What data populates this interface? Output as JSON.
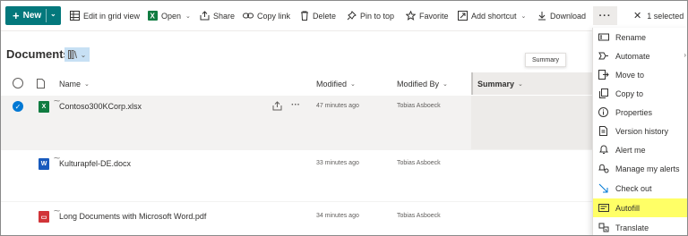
{
  "colors": {
    "accent": "#03787c",
    "selection_blue": "#0078d4",
    "highlight": "#ffff66",
    "excel_green": "#107c41",
    "word_blue": "#185abd",
    "pdf_red": "#d13438"
  },
  "toolbar": {
    "new_label": "New",
    "edit_grid_label": "Edit in grid view",
    "open_label": "Open",
    "share_label": "Share",
    "copy_link_label": "Copy link",
    "delete_label": "Delete",
    "pin_label": "Pin to top",
    "favorite_label": "Favorite",
    "add_shortcut_label": "Add shortcut",
    "download_label": "Download",
    "more_label": "···",
    "selected_label": "1 selected"
  },
  "library": {
    "title": "Documents"
  },
  "tooltip": {
    "text": "Summary"
  },
  "columns": {
    "name": "Name",
    "modified": "Modified",
    "modified_by": "Modified By",
    "summary": "Summary"
  },
  "files": [
    {
      "name": "Contoso300KCorp.xlsx",
      "type": "excel",
      "modified": "47 minutes ago",
      "modified_by": "Tobias Asboeck",
      "selected": true
    },
    {
      "name": "Kulturapfel-DE.docx",
      "type": "word",
      "modified": "33 minutes ago",
      "modified_by": "Tobias Asboeck",
      "selected": false
    },
    {
      "name": "Long Documents with Microsoft Word.pdf",
      "type": "pdf",
      "modified": "34 minutes ago",
      "modified_by": "Tobias Asboeck",
      "selected": false
    }
  ],
  "context_menu": {
    "items": [
      {
        "label": "Rename",
        "icon": "rename-icon"
      },
      {
        "label": "Automate",
        "icon": "automate-icon",
        "submenu": true
      },
      {
        "label": "Move to",
        "icon": "move-icon"
      },
      {
        "label": "Copy to",
        "icon": "copy-icon"
      },
      {
        "label": "Properties",
        "icon": "properties-icon"
      },
      {
        "label": "Version history",
        "icon": "history-icon"
      },
      {
        "label": "Alert me",
        "icon": "bell-icon"
      },
      {
        "label": "Manage my alerts",
        "icon": "manage-alerts-icon"
      },
      {
        "label": "Check out",
        "icon": "checkout-icon"
      },
      {
        "label": "Autofill",
        "icon": "autofill-icon",
        "highlighted": true
      },
      {
        "label": "Translate",
        "icon": "translate-icon"
      }
    ]
  }
}
